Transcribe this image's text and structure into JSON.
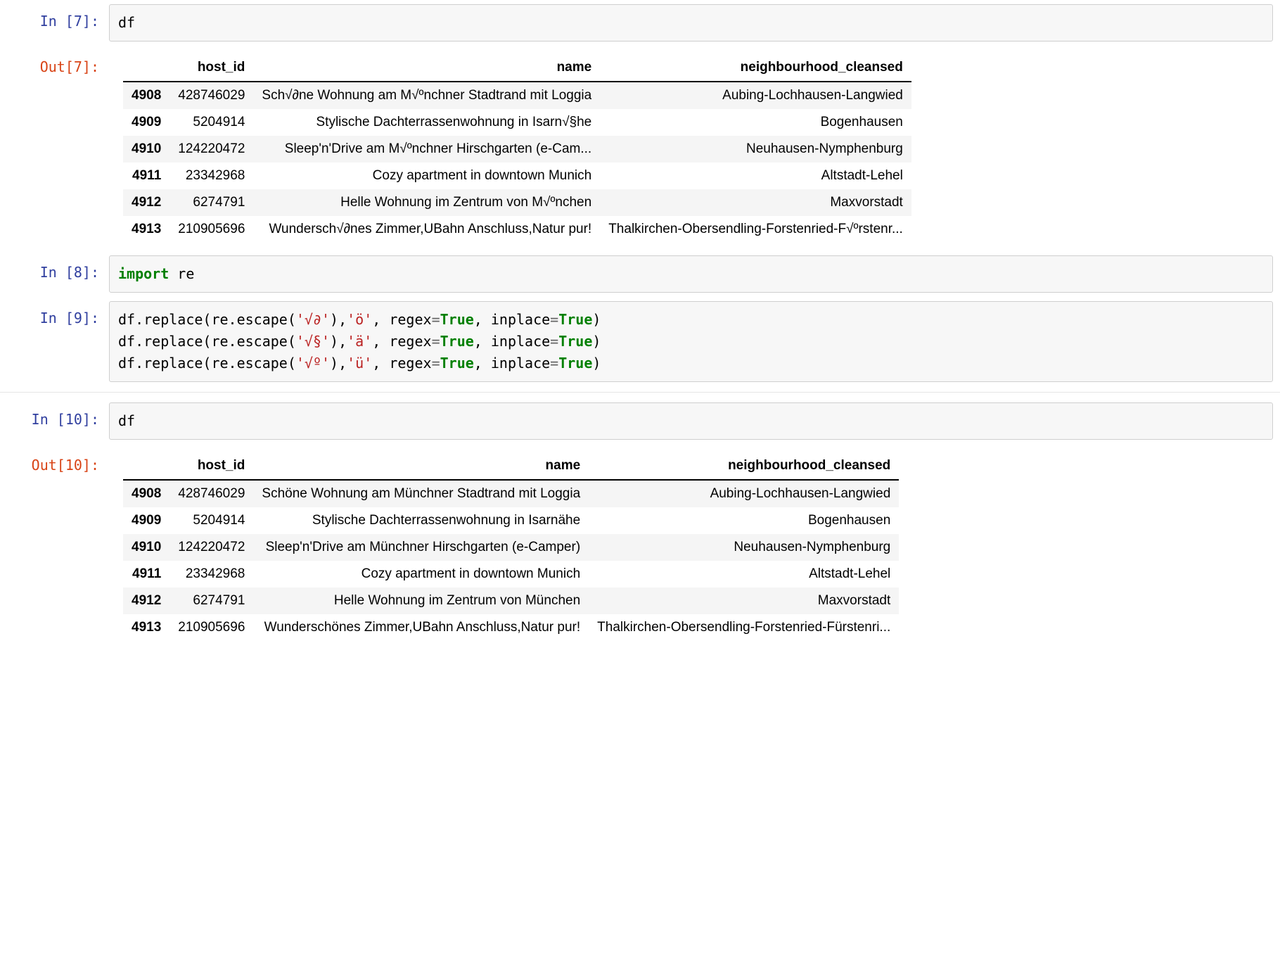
{
  "cells": {
    "c7": {
      "in_prompt": "In [7]:",
      "out_prompt": "Out[7]:",
      "code": "df"
    },
    "c8": {
      "in_prompt": "In [8]:",
      "kw_import": "import",
      "mod": " re"
    },
    "c9": {
      "in_prompt": "In [9]:",
      "prefix1": "df.replace(re.escape(",
      "s1a": "'√∂'",
      "mid1": "),",
      "s1b": "'ö'",
      "regex_txt": ", regex",
      "eq": "=",
      "true_txt": "True",
      "inplace_txt": ", inplace",
      "close": ")",
      "s2a": "'√§'",
      "s2b": "'ä'",
      "s3a": "'√º'",
      "s3b": "'ü'"
    },
    "c10": {
      "in_prompt": "In [10]:",
      "out_prompt": "Out[10]:",
      "code": "df"
    }
  },
  "table7": {
    "headers": {
      "idx": "",
      "h1": "host_id",
      "h2": "name",
      "h3": "neighbourhood_cleansed"
    },
    "rows": [
      {
        "idx": "4908",
        "host_id": "428746029",
        "name": "Sch√∂ne Wohnung am M√ºnchner Stadtrand mit Loggia",
        "nh": "Aubing-Lochhausen-Langwied"
      },
      {
        "idx": "4909",
        "host_id": "5204914",
        "name": "Stylische Dachterrassenwohnung in Isarn√§he",
        "nh": "Bogenhausen"
      },
      {
        "idx": "4910",
        "host_id": "124220472",
        "name": "Sleep'n'Drive am M√ºnchner Hirschgarten (e-Cam...",
        "nh": "Neuhausen-Nymphenburg"
      },
      {
        "idx": "4911",
        "host_id": "23342968",
        "name": "Cozy apartment in downtown Munich",
        "nh": "Altstadt-Lehel"
      },
      {
        "idx": "4912",
        "host_id": "6274791",
        "name": "Helle Wohnung im Zentrum von M√ºnchen",
        "nh": "Maxvorstadt"
      },
      {
        "idx": "4913",
        "host_id": "210905696",
        "name": "Wundersch√∂nes Zimmer,UBahn Anschluss,Natur pur!",
        "nh": "Thalkirchen-Obersendling-Forstenried-F√ºrstenr..."
      }
    ]
  },
  "table10": {
    "headers": {
      "idx": "",
      "h1": "host_id",
      "h2": "name",
      "h3": "neighbourhood_cleansed"
    },
    "rows": [
      {
        "idx": "4908",
        "host_id": "428746029",
        "name": "Schöne Wohnung am Münchner Stadtrand mit Loggia",
        "nh": "Aubing-Lochhausen-Langwied"
      },
      {
        "idx": "4909",
        "host_id": "5204914",
        "name": "Stylische Dachterrassenwohnung in Isarnähe",
        "nh": "Bogenhausen"
      },
      {
        "idx": "4910",
        "host_id": "124220472",
        "name": "Sleep'n'Drive am Münchner Hirschgarten (e-Camper)",
        "nh": "Neuhausen-Nymphenburg"
      },
      {
        "idx": "4911",
        "host_id": "23342968",
        "name": "Cozy apartment in downtown Munich",
        "nh": "Altstadt-Lehel"
      },
      {
        "idx": "4912",
        "host_id": "6274791",
        "name": "Helle Wohnung im Zentrum von München",
        "nh": "Maxvorstadt"
      },
      {
        "idx": "4913",
        "host_id": "210905696",
        "name": "Wunderschönes Zimmer,UBahn Anschluss,Natur pur!",
        "nh": "Thalkirchen-Obersendling-Forstenried-Fürstenri..."
      }
    ]
  }
}
